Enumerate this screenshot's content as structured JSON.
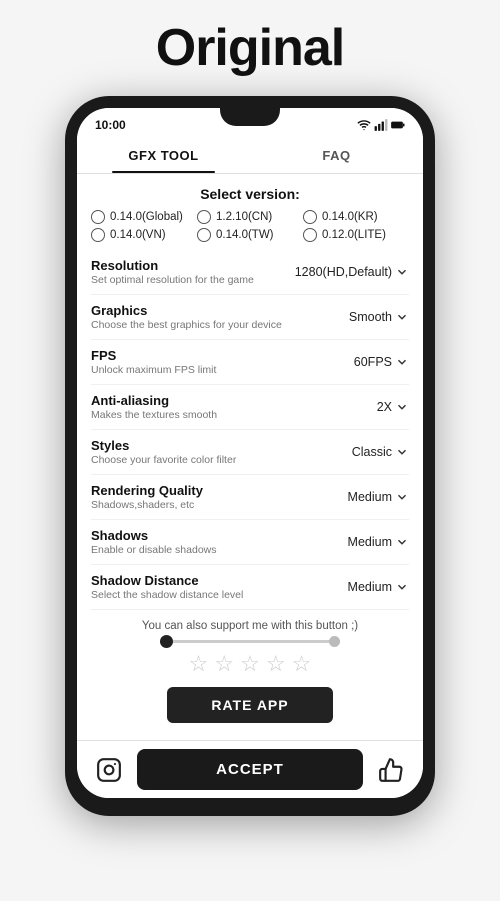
{
  "page": {
    "title": "Original"
  },
  "status_bar": {
    "time": "10:00"
  },
  "tabs": [
    {
      "id": "gfx",
      "label": "GFX TOOL",
      "active": true
    },
    {
      "id": "faq",
      "label": "FAQ",
      "active": false
    }
  ],
  "version_section": {
    "title": "Select version:",
    "options": [
      {
        "id": "global",
        "label": "0.14.0(Global)"
      },
      {
        "id": "cn",
        "label": "1.2.10(CN)"
      },
      {
        "id": "kr",
        "label": "0.14.0(KR)"
      },
      {
        "id": "vn",
        "label": "0.14.0(VN)"
      },
      {
        "id": "tw",
        "label": "0.14.0(TW)"
      },
      {
        "id": "lite",
        "label": "0.12.0(LITE)"
      }
    ]
  },
  "settings": [
    {
      "id": "resolution",
      "label": "Resolution",
      "desc": "Set optimal resolution for the game",
      "value": "1280(HD,Default)"
    },
    {
      "id": "graphics",
      "label": "Graphics",
      "desc": "Choose the best graphics for your device",
      "value": "Smooth"
    },
    {
      "id": "fps",
      "label": "FPS",
      "desc": "Unlock maximum FPS limit",
      "value": "60FPS"
    },
    {
      "id": "antialiasing",
      "label": "Anti-aliasing",
      "desc": "Makes the textures smooth",
      "value": "2X"
    },
    {
      "id": "styles",
      "label": "Styles",
      "desc": "Choose your favorite color filter",
      "value": "Classic"
    },
    {
      "id": "rendering",
      "label": "Rendering Quality",
      "desc": "Shadows,shaders, etc",
      "value": "Medium"
    },
    {
      "id": "shadows",
      "label": "Shadows",
      "desc": "Enable or disable shadows",
      "value": "Medium"
    },
    {
      "id": "shadow_distance",
      "label": "Shadow Distance",
      "desc": "Select the shadow distance level",
      "value": "Medium"
    }
  ],
  "support": {
    "text": "You can also support me with this button ;)",
    "rate_label": "RATE APP",
    "accept_label": "ACCEPT"
  }
}
